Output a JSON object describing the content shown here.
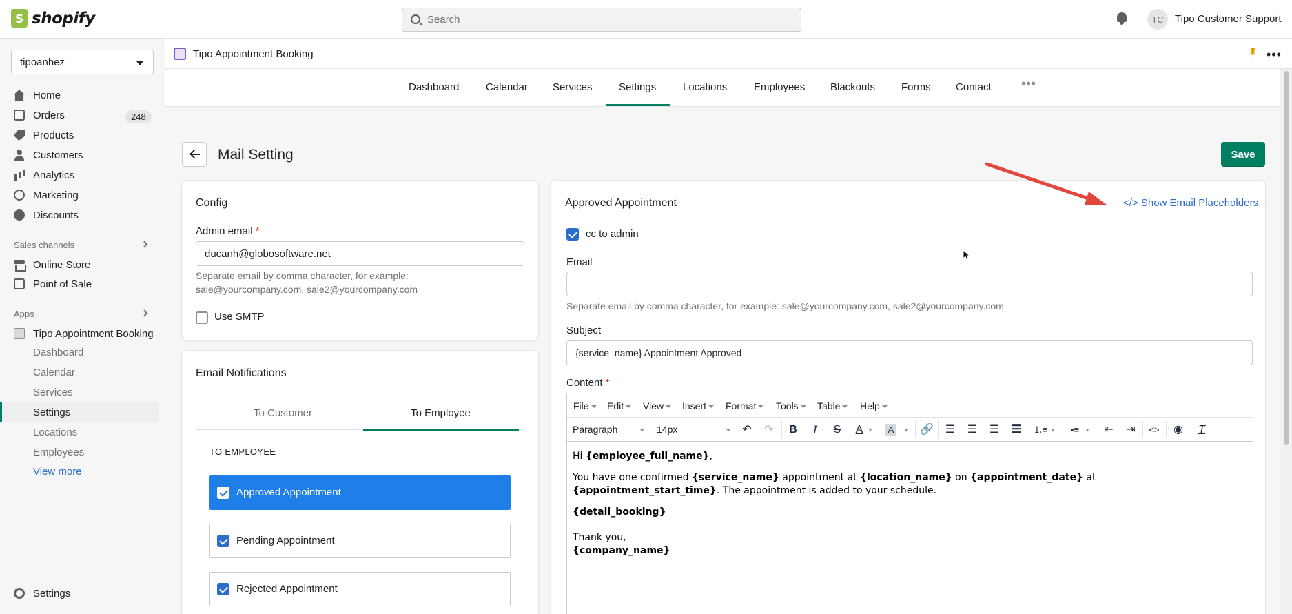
{
  "topbar": {
    "logo_text": "shopify",
    "search_placeholder": "Search",
    "avatar_initials": "TC",
    "user_name": "Tipo Customer Support"
  },
  "sidebar": {
    "store": "tipoanhez",
    "items": [
      {
        "label": "Home",
        "icon": "home-icon"
      },
      {
        "label": "Orders",
        "icon": "orders-icon",
        "badge": "248"
      },
      {
        "label": "Products",
        "icon": "tag-icon"
      },
      {
        "label": "Customers",
        "icon": "person-icon"
      },
      {
        "label": "Analytics",
        "icon": "bar-chart-icon"
      },
      {
        "label": "Marketing",
        "icon": "target-icon"
      },
      {
        "label": "Discounts",
        "icon": "discount-icon"
      }
    ],
    "sales_channels_label": "Sales channels",
    "channels": [
      {
        "label": "Online Store",
        "icon": "store-icon"
      },
      {
        "label": "Point of Sale",
        "icon": "pos-icon"
      }
    ],
    "apps_label": "Apps",
    "app_name": "Tipo Appointment Booking",
    "app_subitems": [
      "Dashboard",
      "Calendar",
      "Services",
      "Settings",
      "Locations",
      "Employees"
    ],
    "view_more": "View more",
    "settings": "Settings"
  },
  "app_header": {
    "title": "Tipo Appointment Booking"
  },
  "tabs": [
    "Dashboard",
    "Calendar",
    "Services",
    "Settings",
    "Locations",
    "Employees",
    "Blackouts",
    "Forms",
    "Contact"
  ],
  "active_tab": "Settings",
  "page": {
    "title": "Mail Setting",
    "save_label": "Save"
  },
  "config": {
    "title": "Config",
    "admin_email_label": "Admin email",
    "required_mark": "*",
    "admin_email_value": "ducanh@globosoftware.net",
    "help_line1": "Separate email by comma character, for example:",
    "help_line2": "sale@yourcompany.com, sale2@yourcompany.com",
    "use_smtp_label": "Use SMTP",
    "use_smtp_checked": false
  },
  "notifications": {
    "title": "Email Notifications",
    "tab_customer": "To Customer",
    "tab_employee": "To Employee",
    "section_label": "TO EMPLOYEE",
    "items": [
      {
        "label": "Approved Appointment",
        "checked": true,
        "active": true
      },
      {
        "label": "Pending Appointment",
        "checked": true,
        "active": false
      },
      {
        "label": "Rejected Appointment",
        "checked": true,
        "active": false
      }
    ]
  },
  "detail": {
    "title": "Approved Appointment",
    "placeholders_link": "</> Show Email Placeholders",
    "cc_admin_label": "cc to admin",
    "cc_admin_checked": true,
    "email_label": "Email",
    "email_value": "",
    "email_help": "Separate email by comma character, for example: sale@yourcompany.com, sale2@yourcompany.com",
    "subject_label": "Subject",
    "subject_value": "{service_name} Appointment Approved",
    "content_label": "Content",
    "required_mark": "*"
  },
  "editor": {
    "menus": [
      "File",
      "Edit",
      "View",
      "Insert",
      "Format",
      "Tools",
      "Table",
      "Help"
    ],
    "block_format": "Paragraph",
    "font_size": "14px",
    "content": {
      "hi": "Hi ",
      "employee_full_name": "{employee_full_name}",
      "comma": ",",
      "confirmed_pre": "You have one confirmed ",
      "service_name": "{service_name}",
      "appt_at": " appointment at ",
      "location_name": "{location_name}",
      "on": " on ",
      "appointment_date": "{appointment_date}",
      "at": " at",
      "appointment_start_time": "{appointment_start_time}",
      "added": ". The appointment is added to your schedule.",
      "detail_booking": "{detail_booking}",
      "thank_you": "Thank you,",
      "company_name": "{company_name}"
    }
  },
  "colors": {
    "accent_green": "#008060",
    "link_blue": "#2c6ecb",
    "active_item_blue": "#1f7ee8",
    "annotation_arrow": "#e0483e"
  }
}
